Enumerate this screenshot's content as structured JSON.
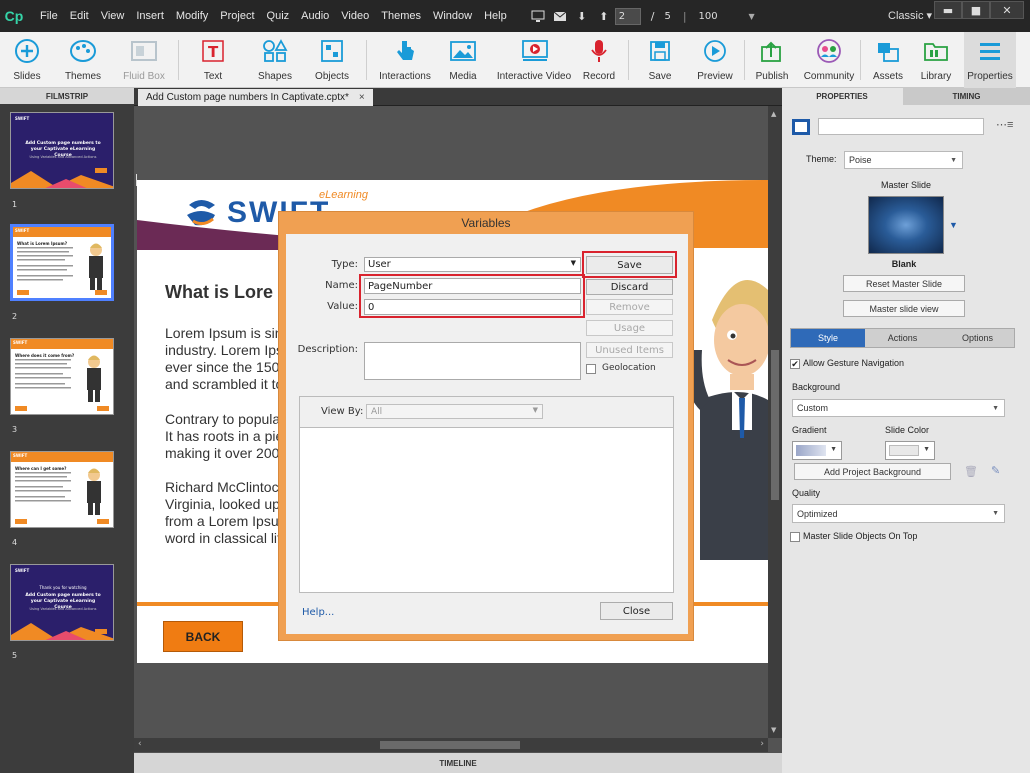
{
  "app": {
    "logo": "Cp",
    "workspace": "Classic ▾",
    "page_current": "2",
    "page_sep": "/",
    "page_total": "5",
    "zoom": "100"
  },
  "menu": [
    "File",
    "Edit",
    "View",
    "Insert",
    "Modify",
    "Project",
    "Quiz",
    "Audio",
    "Video",
    "Themes",
    "Window",
    "Help"
  ],
  "toolbar": {
    "slides": "Slides",
    "themes": "Themes",
    "fluid_box": "Fluid Box",
    "text": "Text",
    "shapes": "Shapes",
    "objects": "Objects",
    "interactions": "Interactions",
    "media": "Media",
    "interactive_video": "Interactive Video",
    "record": "Record",
    "save": "Save",
    "preview": "Preview",
    "publish": "Publish",
    "community": "Community",
    "assets": "Assets",
    "library": "Library",
    "properties": "Properties"
  },
  "filmstrip": {
    "title": "FILMSTRIP",
    "slides": [
      "1",
      "2",
      "3",
      "4",
      "5"
    ]
  },
  "document": {
    "tab": "Add Custom page numbers In Captivate.cptx*",
    "close": "×"
  },
  "slide": {
    "logo_text": "SWIFT",
    "logo_tag": "eLearning",
    "heading": "What is Lore",
    "p1": [
      "Lorem Ipsum is sin",
      "industry. Lorem Ips",
      "ever since the 1500",
      "and scrambled it to"
    ],
    "p2": [
      "Contrary to popula",
      "It has roots in a pie",
      "making it over 200"
    ],
    "p3": [
      "Richard McClintock",
      "Virginia, looked up",
      "from a Lorem Ipsur",
      "word in classical lit"
    ],
    "back": "BACK"
  },
  "thumbs": {
    "t1_title": "Add Custom page numbers to your Captivate eLearning Course",
    "t1_sub": "Using Variables and Advanced Actions",
    "t2_title": "What is Lorem Ipsum?",
    "t3_title": "Where does it come from?",
    "t4_title": "Where can I get some?",
    "t5_thanks": "Thank you for watching",
    "brand": "SWIFT"
  },
  "variables_dialog": {
    "title": "Variables",
    "type_label": "Type:",
    "type_value": "User",
    "name_label": "Name:",
    "name_value": "PageNumber",
    "value_label": "Value:",
    "value_value": "0",
    "description_label": "Description:",
    "save": "Save",
    "discard": "Discard",
    "remove": "Remove",
    "usage": "Usage",
    "unused_items": "Unused Items",
    "geolocation": "Geolocation",
    "view_by_label": "View By:",
    "view_by_value": "All",
    "help": "Help...",
    "close": "Close"
  },
  "properties": {
    "tab_properties": "PROPERTIES",
    "tab_timing": "TIMING",
    "theme_label": "Theme:",
    "theme_value": "Poise",
    "master_slide_label": "Master Slide",
    "master_name": "Blank",
    "reset_master": "Reset Master Slide",
    "master_view": "Master slide view",
    "sub_tabs": [
      "Style",
      "Actions",
      "Options"
    ],
    "allow_gesture": "Allow Gesture Navigation",
    "background_label": "Background",
    "background_value": "Custom",
    "gradient_label": "Gradient",
    "slide_color_label": "Slide Color",
    "add_bg": "Add Project Background",
    "quality_label": "Quality",
    "quality_value": "Optimized",
    "master_on_top": "Master Slide Objects On Top"
  },
  "timeline": "TIMELINE",
  "colors": {
    "accent_orange": "#f0a052",
    "highlight_red": "#d9232e",
    "selection_blue": "#4f80ff",
    "brand_purple": "#2b1f6b"
  }
}
